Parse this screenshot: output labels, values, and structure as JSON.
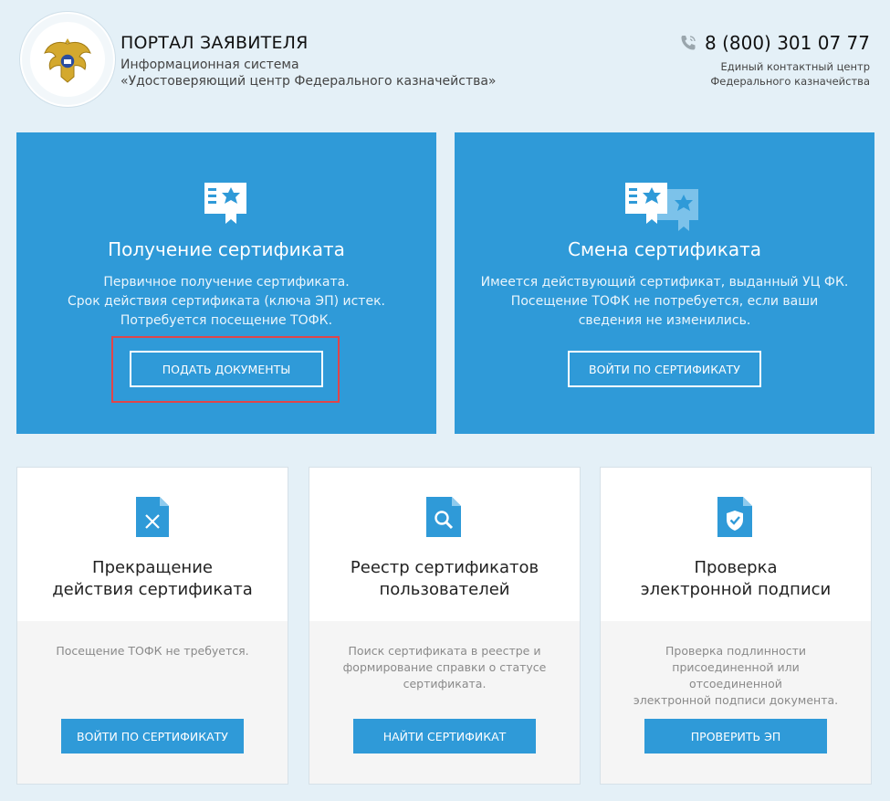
{
  "header": {
    "title": "ПОРТАЛ ЗАЯВИТЕЛЯ",
    "subtitle_line1": "Информационная система",
    "subtitle_line2": "«Удостоверяющий центр Федерального казначейства»",
    "phone": "8 (800) 301 07 77",
    "contact_line1": "Единый контактный центр",
    "contact_line2": "Федерального казначейства",
    "logo_icon": "double-headed-eagle-emblem",
    "phone_icon": "phone-icon"
  },
  "primary_cards": [
    {
      "title": "Получение сертификата",
      "desc_lines": [
        "Первичное получение сертификата.",
        "Срок действия сертификата (ключа ЭП) истек.",
        "Потребуется посещение ТОФК."
      ],
      "button": "ПОДАТЬ ДОКУМЕНТЫ",
      "icon": "certificate-icon",
      "highlighted": true
    },
    {
      "title": "Смена сертификата",
      "desc_lines": [
        "Имеется действующий сертификат, выданный УЦ ФК.",
        "Посещение ТОФК не потребуется, если ваши",
        "сведения не изменились."
      ],
      "button": "ВОЙТИ ПО СЕРТИФИКАТУ",
      "icon": "certificate-change-icon"
    }
  ],
  "secondary_cards": [
    {
      "title_line1": "Прекращение",
      "title_line2": "действия сертификата",
      "desc_lines": [
        "Посещение ТОФК не требуется."
      ],
      "button": "ВОЙТИ ПО СЕРТИФИКАТУ",
      "icon": "document-cross-icon"
    },
    {
      "title_line1": "Реестр сертификатов",
      "title_line2": "пользователей",
      "desc_lines": [
        "Поиск сертификата в реестре и",
        "формирование справки о статусе",
        "сертификата."
      ],
      "button": "НАЙТИ СЕРТИФИКАТ",
      "icon": "document-search-icon"
    },
    {
      "title_line1": "Проверка",
      "title_line2": "электронной подписи",
      "desc_lines": [
        "Проверка подлинности",
        "присоединенной или отсоединенной",
        "электронной подписи документа."
      ],
      "button": "ПРОВЕРИТЬ ЭП",
      "icon": "document-shield-icon"
    }
  ],
  "colors": {
    "background": "#e4f0f7",
    "accent": "#2f9ad8",
    "highlight": "#e0454a"
  }
}
